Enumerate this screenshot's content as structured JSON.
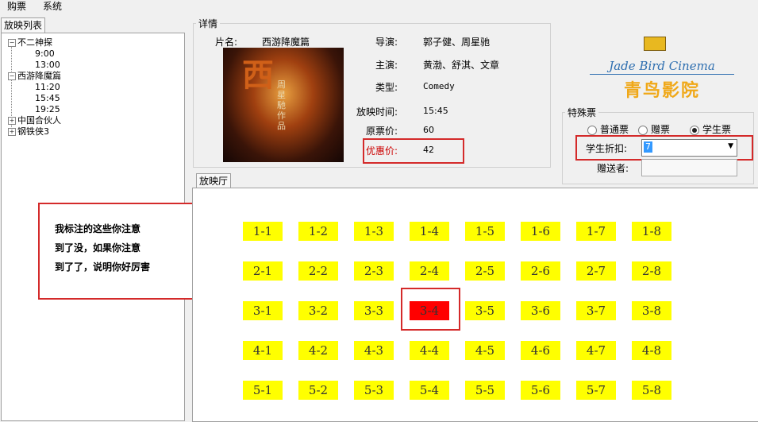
{
  "menu": [
    "购票",
    "系统"
  ],
  "schedule": {
    "tab_label": "放映列表",
    "movies": [
      {
        "title": "不二神探",
        "expanded": true,
        "times": [
          "9:00",
          "13:00"
        ]
      },
      {
        "title": "西游降魔篇",
        "expanded": true,
        "times": [
          "11:20",
          "15:45",
          "19:25"
        ]
      },
      {
        "title": "中国合伙人",
        "expanded": false,
        "times": []
      },
      {
        "title": "钢铁侠3",
        "expanded": false,
        "times": []
      }
    ]
  },
  "details": {
    "group_title": "详情",
    "title_label": "片名:",
    "title": "西游降魔篇",
    "director_label": "导演:",
    "director": "郭子健、周星驰",
    "actors_label": "主演:",
    "actors": "黄渤、舒淇、文章",
    "type_label": "类型:",
    "type": "Comedy",
    "time_label": "放映时间:",
    "time": "15:45",
    "price_label": "原票价:",
    "price": "60",
    "discount_label": "优惠价:",
    "discount": "42",
    "poster_text": "周星馳作品"
  },
  "logo": {
    "english": "Jade Bird Cinema",
    "chinese": "青鸟影院"
  },
  "special": {
    "group_title": "特殊票",
    "options": [
      "普通票",
      "赠票",
      "学生票"
    ],
    "selected": 2,
    "discount_label": "学生折扣:",
    "discount_value": "7",
    "giver_label": "赠送者:",
    "giver_value": ""
  },
  "hall": {
    "tab_label": "放映厅",
    "selected_seat": "3-4",
    "rows": [
      [
        "1-1",
        "1-2",
        "1-3",
        "1-4",
        "1-5",
        "1-6",
        "1-7",
        "1-8"
      ],
      [
        "2-1",
        "2-2",
        "2-3",
        "2-4",
        "2-5",
        "2-6",
        "2-7",
        "2-8"
      ],
      [
        "3-1",
        "3-2",
        "3-3",
        "3-4",
        "3-5",
        "3-6",
        "3-7",
        "3-8"
      ],
      [
        "4-1",
        "4-2",
        "4-3",
        "4-4",
        "4-5",
        "4-6",
        "4-7",
        "4-8"
      ],
      [
        "5-1",
        "5-2",
        "5-3",
        "5-4",
        "5-5",
        "5-6",
        "5-7",
        "5-8"
      ]
    ]
  },
  "annotation": {
    "lines": [
      "我标注的这些你注意",
      "到了没，如果你注意",
      "到了了，说明你好厉害"
    ]
  },
  "colors": {
    "seat": "#ffff00",
    "seat_selected": "#ff0000",
    "highlight": "#d42a2a",
    "discount_text": "#cc0000"
  }
}
